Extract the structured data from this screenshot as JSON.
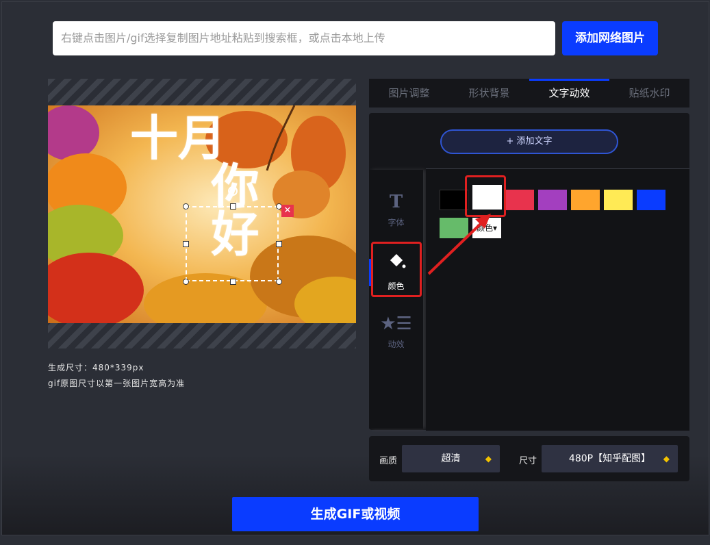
{
  "search": {
    "placeholder": "右键点击图片/gif选择复制图片地址粘贴到搜索框，或点击本地上传"
  },
  "add_network_image_label": "添加网络图片",
  "preview": {
    "overlay_text_1": "十月",
    "overlay_text_2": "你好",
    "size_caption": "生成尺寸：480*339px",
    "size_note": "gif原图尺寸以第一张图片宽高为准"
  },
  "tabs": [
    {
      "label": "图片调整",
      "active": false
    },
    {
      "label": "形状背景",
      "active": false
    },
    {
      "label": "文字动效",
      "active": true
    },
    {
      "label": "贴纸水印",
      "active": false
    }
  ],
  "add_text_label": "+ 添加文字",
  "side_menu": [
    {
      "icon": "text-icon",
      "label": "字体",
      "active": false
    },
    {
      "icon": "paint-bucket-icon",
      "label": "颜色",
      "active": true
    },
    {
      "icon": "star-list-icon",
      "label": "动效",
      "active": false
    }
  ],
  "colors": [
    {
      "name": "black",
      "hex": "#000000"
    },
    {
      "name": "white",
      "hex": "#ffffff",
      "selected": true
    },
    {
      "name": "red",
      "hex": "#e8334d"
    },
    {
      "name": "purple",
      "hex": "#a33fbf"
    },
    {
      "name": "orange",
      "hex": "#ffa52d"
    },
    {
      "name": "yellow",
      "hex": "#ffea55"
    },
    {
      "name": "blue",
      "hex": "#0a3cff"
    },
    {
      "name": "green",
      "hex": "#66bb6a"
    }
  ],
  "more_color_label": "颜色",
  "settings": {
    "quality_label": "画质",
    "quality_value": "超清",
    "size_label": "尺寸",
    "size_value": "480P【知乎配图】"
  },
  "generate_label": "生成GIF或视频"
}
